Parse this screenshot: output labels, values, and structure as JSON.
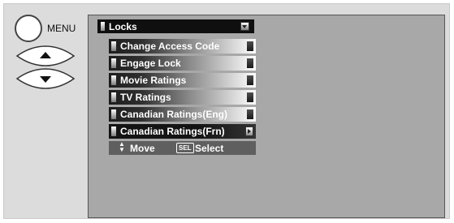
{
  "remote": {
    "menu_label": "MENU"
  },
  "menu": {
    "title": "Locks",
    "items": [
      {
        "label": "Change Access Code",
        "selected": false
      },
      {
        "label": "Engage Lock",
        "selected": false
      },
      {
        "label": "Movie Ratings",
        "selected": false
      },
      {
        "label": "TV Ratings",
        "selected": false
      },
      {
        "label": "Canadian Ratings(Eng)",
        "selected": false
      },
      {
        "label": "Canadian Ratings(Frn)",
        "selected": true
      }
    ]
  },
  "help": {
    "move_label": "Move",
    "sel_key": "SEL",
    "select_label": "Select"
  },
  "icons": {
    "menu_button": "circle-button-icon",
    "up": "up-arrow-button-icon",
    "down": "down-arrow-button-icon",
    "updown": "updown-arrows-icon"
  },
  "colors": {
    "screen_bg": "#a8a8a8",
    "title_bg": "#0f0f0f",
    "help_bg": "#5f5f5f"
  }
}
